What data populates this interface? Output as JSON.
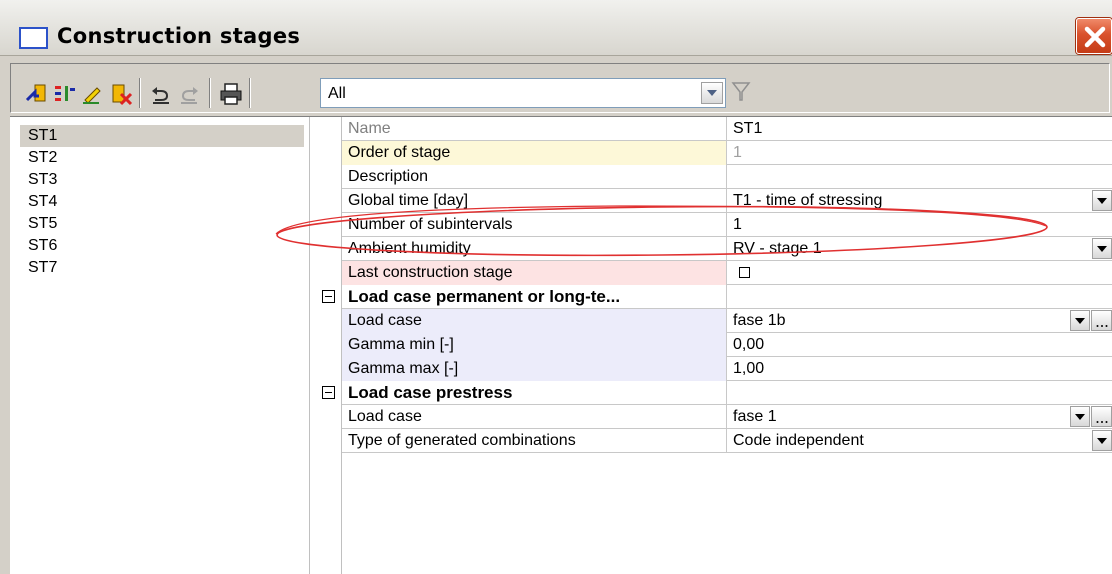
{
  "window": {
    "title": "Construction stages"
  },
  "toolbar": {
    "filter_value": "All",
    "icons": [
      "new-stage-icon",
      "insert-stage-icon",
      "edit-icon",
      "delete-icon",
      "undo-icon",
      "redo-icon",
      "print-icon",
      "filter-icon"
    ]
  },
  "stages": [
    "ST1",
    "ST2",
    "ST3",
    "ST4",
    "ST5",
    "ST6",
    "ST7"
  ],
  "selected_stage": "ST1",
  "properties": {
    "name": {
      "label": "Name",
      "value": "ST1"
    },
    "order": {
      "label": "Order of stage",
      "value": "1"
    },
    "description": {
      "label": "Description",
      "value": ""
    },
    "global_time": {
      "label": "Global time [day]",
      "value": "T1 - time of stressing"
    },
    "subintervals": {
      "label": "Number of subintervals",
      "value": "1"
    },
    "humidity": {
      "label": "Ambient humidity",
      "value": "RV - stage 1"
    },
    "last_stage": {
      "label": "Last construction stage",
      "value": ""
    },
    "section_permanent": {
      "label": "Load case permanent or long-te..."
    },
    "perm_load_case": {
      "label": "Load case",
      "value": "fase 1b"
    },
    "gamma_min": {
      "label": "Gamma min [-]",
      "value": "0,00"
    },
    "gamma_max": {
      "label": "Gamma max [-]",
      "value": "1,00"
    },
    "section_prestress": {
      "label": "Load case prestress"
    },
    "prestress_load_case": {
      "label": "Load case",
      "value": "fase 1"
    },
    "combination_type": {
      "label": "Type of generated combinations",
      "value": "Code independent"
    }
  },
  "colors": {
    "highlight_ellipse": "#e03030",
    "close_button": "#d9522d",
    "selection": "#d4d0c8"
  }
}
